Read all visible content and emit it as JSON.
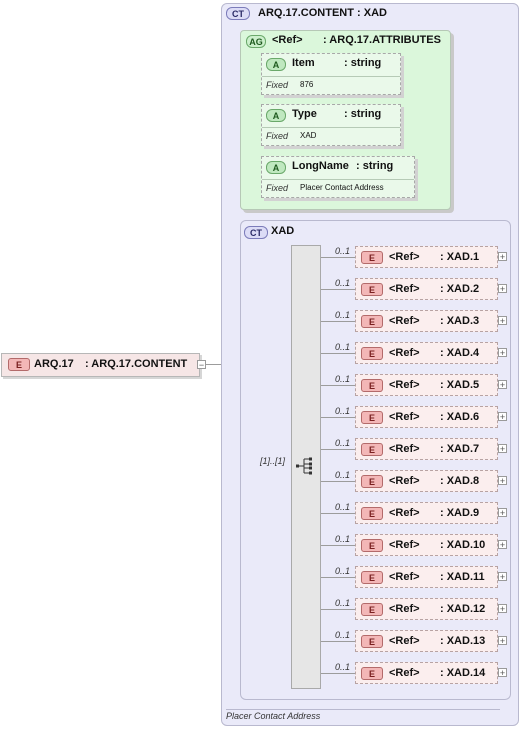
{
  "root": {
    "tag": "E",
    "name": "ARQ.17",
    "type": ": ARQ.17.CONTENT",
    "toggle": "−"
  },
  "complex_type": {
    "tag": "CT",
    "title": "ARQ.17.CONTENT : XAD",
    "documentation": "Placer Contact Address"
  },
  "attribute_group": {
    "tag": "AG",
    "ref": "<Ref>",
    "type": ": ARQ.17.ATTRIBUTES",
    "attributes": [
      {
        "tag": "A",
        "name": "Item",
        "type": ": string",
        "fixed_label": "Fixed",
        "fixed_value": "876"
      },
      {
        "tag": "A",
        "name": "Type",
        "type": ": string",
        "fixed_label": "Fixed",
        "fixed_value": "XAD"
      },
      {
        "tag": "A",
        "name": "LongName",
        "type": ": string",
        "fixed_label": "Fixed",
        "fixed_value": "Placer Contact Address"
      }
    ]
  },
  "sequence": {
    "tag": "CT",
    "title": "XAD",
    "occurrence": "[1]..[1]",
    "items": [
      {
        "tag": "E",
        "ref": "<Ref>",
        "type": ": XAD.1",
        "occ": "0..1",
        "toggle": "+"
      },
      {
        "tag": "E",
        "ref": "<Ref>",
        "type": ": XAD.2",
        "occ": "0..1",
        "toggle": "+"
      },
      {
        "tag": "E",
        "ref": "<Ref>",
        "type": ": XAD.3",
        "occ": "0..1",
        "toggle": "+"
      },
      {
        "tag": "E",
        "ref": "<Ref>",
        "type": ": XAD.4",
        "occ": "0..1",
        "toggle": "+"
      },
      {
        "tag": "E",
        "ref": "<Ref>",
        "type": ": XAD.5",
        "occ": "0..1",
        "toggle": "+"
      },
      {
        "tag": "E",
        "ref": "<Ref>",
        "type": ": XAD.6",
        "occ": "0..1",
        "toggle": "+"
      },
      {
        "tag": "E",
        "ref": "<Ref>",
        "type": ": XAD.7",
        "occ": "0..1",
        "toggle": "+"
      },
      {
        "tag": "E",
        "ref": "<Ref>",
        "type": ": XAD.8",
        "occ": "0..1",
        "toggle": "+"
      },
      {
        "tag": "E",
        "ref": "<Ref>",
        "type": ": XAD.9",
        "occ": "0..1",
        "toggle": "+"
      },
      {
        "tag": "E",
        "ref": "<Ref>",
        "type": ": XAD.10",
        "occ": "0..1",
        "toggle": "+"
      },
      {
        "tag": "E",
        "ref": "<Ref>",
        "type": ": XAD.11",
        "occ": "0..1",
        "toggle": "+"
      },
      {
        "tag": "E",
        "ref": "<Ref>",
        "type": ": XAD.12",
        "occ": "0..1",
        "toggle": "+"
      },
      {
        "tag": "E",
        "ref": "<Ref>",
        "type": ": XAD.13",
        "occ": "0..1",
        "toggle": "+"
      },
      {
        "tag": "E",
        "ref": "<Ref>",
        "type": ": XAD.14",
        "occ": "0..1",
        "toggle": "+"
      }
    ]
  }
}
